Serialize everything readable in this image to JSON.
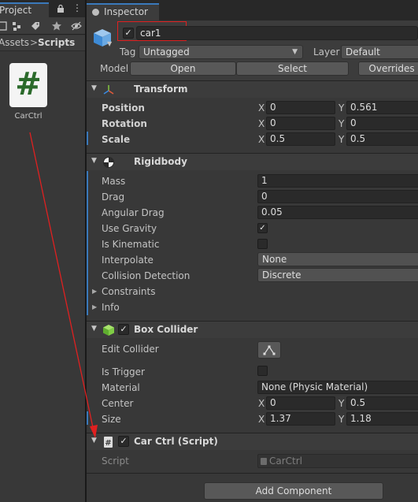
{
  "project": {
    "tab_label": "Project",
    "lock_icon": "lock-icon",
    "more_label": "⋮",
    "toolbar_icons": [
      "create-icon",
      "filter-type-icon",
      "label-icon",
      "favorite-star-icon",
      "hidden-eye-icon"
    ],
    "breadcrumb": {
      "parent": "Assets",
      "separator": ">",
      "current": "Scripts"
    },
    "asset": {
      "label": "CarCtrl",
      "glyph": "#"
    }
  },
  "inspector": {
    "tab_label": "Inspector",
    "object": {
      "active": true,
      "name": "car1",
      "tag_label": "Tag",
      "tag_value": "Untagged",
      "layer_label": "Layer",
      "layer_value": "Default",
      "model_label": "Model",
      "open_label": "Open",
      "select_label": "Select",
      "overrides_label": "Overrides"
    },
    "transform": {
      "title": "Transform",
      "position_label": "Position",
      "rotation_label": "Rotation",
      "scale_label": "Scale",
      "position": {
        "x": "0",
        "y": "0.561"
      },
      "rotation": {
        "x": "0",
        "y": "0"
      },
      "scale": {
        "x": "0.5",
        "y": "0.5"
      },
      "x_label": "X",
      "y_label": "Y"
    },
    "rigidbody": {
      "title": "Rigidbody",
      "mass_label": "Mass",
      "mass": "1",
      "drag_label": "Drag",
      "drag": "0",
      "angular_drag_label": "Angular Drag",
      "angular_drag": "0.05",
      "use_gravity_label": "Use Gravity",
      "use_gravity": true,
      "is_kinematic_label": "Is Kinematic",
      "is_kinematic": false,
      "interpolate_label": "Interpolate",
      "interpolate": "None",
      "collision_label": "Collision Detection",
      "collision": "Discrete",
      "constraints_label": "Constraints",
      "info_label": "Info"
    },
    "box_collider": {
      "title": "Box Collider",
      "enabled": true,
      "edit_collider_label": "Edit Collider",
      "is_trigger_label": "Is Trigger",
      "is_trigger": false,
      "material_label": "Material",
      "material": "None (Physic Material)",
      "center_label": "Center",
      "center": {
        "x": "0",
        "y": "0.5"
      },
      "size_label": "Size",
      "size": {
        "x": "1.37",
        "y": "1.18"
      }
    },
    "car_ctrl": {
      "title": "Car Ctrl (Script)",
      "enabled": true,
      "script_label": "Script",
      "script_value": "CarCtrl"
    },
    "add_component_label": "Add Component"
  },
  "colors": {
    "accent_blue": "#3a79bb",
    "highlight_red": "#e02020",
    "panel_bg": "#383838",
    "script_green": "#2b6a2b"
  }
}
